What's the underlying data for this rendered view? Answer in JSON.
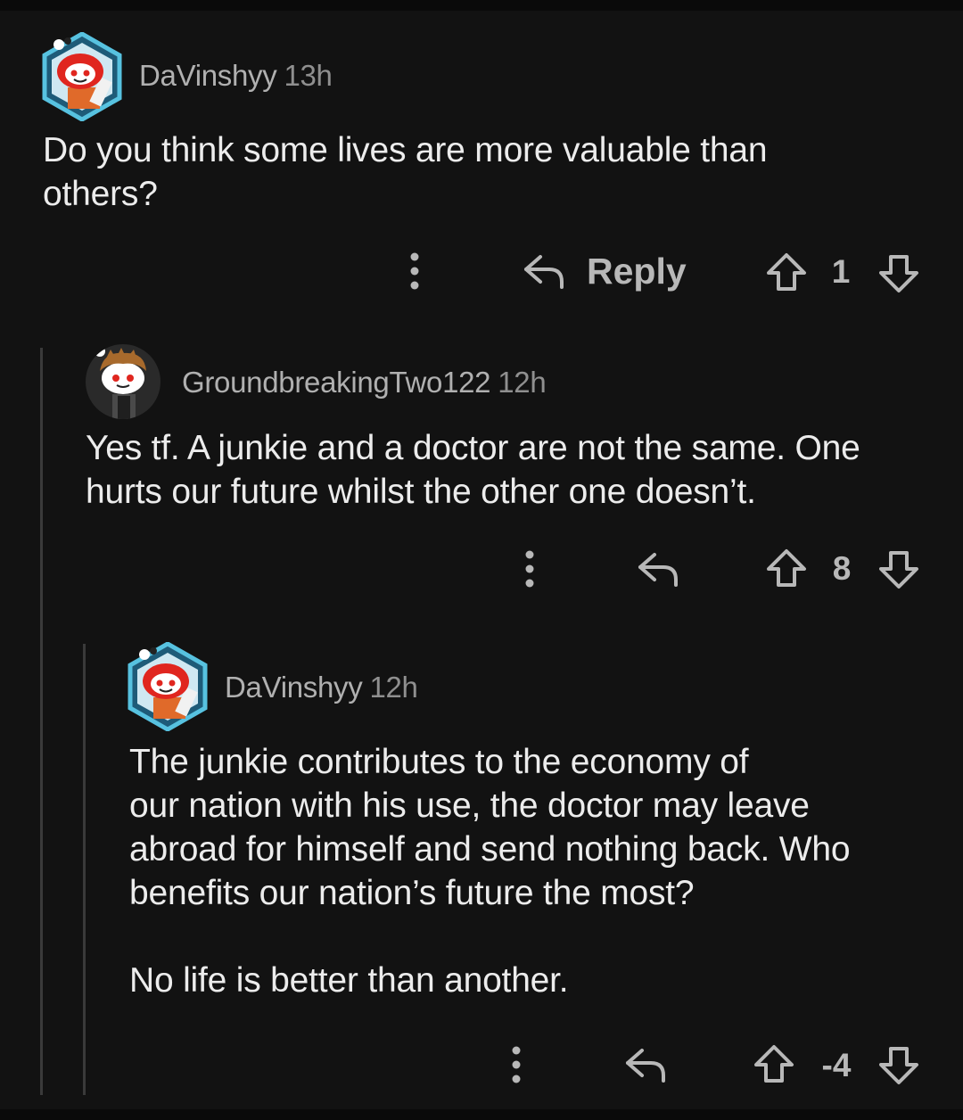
{
  "comments": [
    {
      "username": "DaVinshyy",
      "time": "13h",
      "body": [
        "Do you think some lives are more valuable than",
        "others?"
      ],
      "reply_label": "Reply",
      "score": "1",
      "avatar_icon": "snoo-avatar-red-icon"
    },
    {
      "username": "GroundbreakingTwo122",
      "time": "12h",
      "body": [
        "Yes tf. A junkie and a doctor are not the same. One",
        "hurts our future whilst the other one doesn’t."
      ],
      "score": "8",
      "avatar_icon": "snoo-avatar-brown-hair-icon"
    },
    {
      "username": "DaVinshyy",
      "time": "12h",
      "body": [
        "The junkie contributes to the economy of",
        "our nation with his use, the doctor may leave",
        "abroad for himself and send nothing back. Who",
        "benefits our nation’s future the most?",
        "",
        "No life is better than another."
      ],
      "score": "-4",
      "avatar_icon": "snoo-avatar-red-icon"
    }
  ],
  "colors": {
    "background": "#121212",
    "text": "#ececec",
    "muted": "#b0b0b0",
    "thread_line": "#3a3a3a"
  }
}
